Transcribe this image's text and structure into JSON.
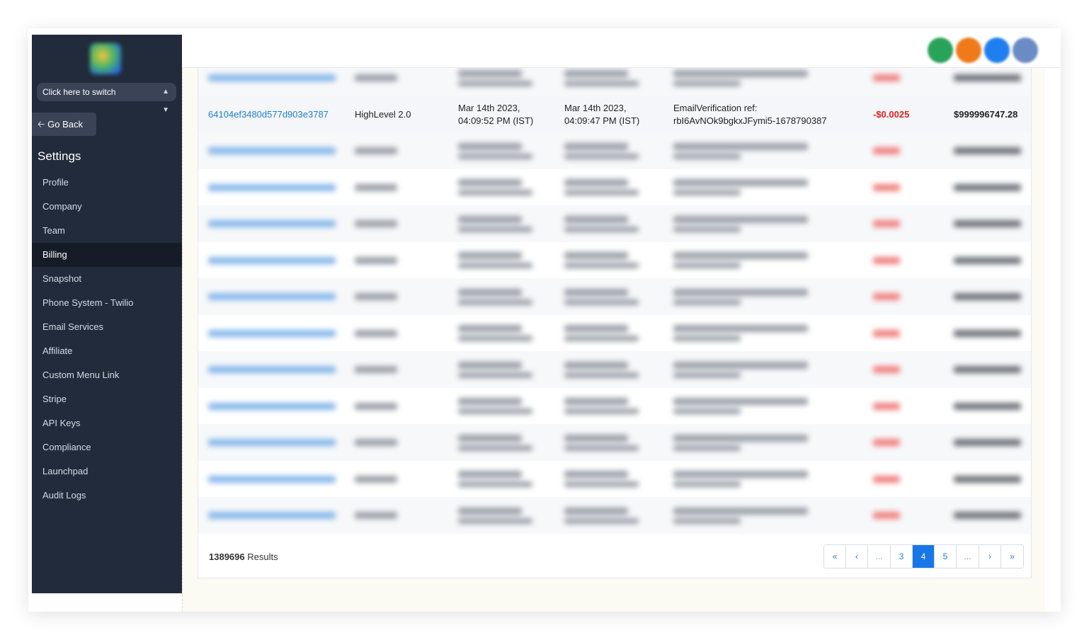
{
  "sidebar": {
    "switcher_label": "Click here to switch",
    "go_back": "Go Back",
    "settings_title": "Settings",
    "items": [
      "Profile",
      "Company",
      "Team",
      "Billing",
      "Snapshot",
      "Phone System - Twilio",
      "Email Services",
      "Affiliate",
      "Custom Menu Link",
      "Stripe",
      "API Keys",
      "Compliance",
      "Launchpad",
      "Audit Logs"
    ],
    "active_item": "Billing"
  },
  "topbar": {
    "avatars": [
      {
        "icon": "avatar-green-icon",
        "color": "#2aa35a"
      },
      {
        "icon": "avatar-orange-icon",
        "color": "#f07a1a"
      },
      {
        "icon": "avatar-blue-icon",
        "color": "#1f7ff0"
      },
      {
        "icon": "avatar-slate-icon",
        "color": "#6b8bc4"
      }
    ]
  },
  "transactions": {
    "visible_row": {
      "id": "64104ef3480d577d903e3787",
      "source": "HighLevel 2.0",
      "created_line1": "Mar 14th 2023,",
      "created_line2": "04:09:52 PM (IST)",
      "updated_line1": "Mar 14th 2023,",
      "updated_line2": "04:09:47 PM (IST)",
      "desc_line1": "EmailVerification ref:",
      "desc_line2": "rbI6AvNOk9bgkxJFymi5-1678790387",
      "amount": "-$0.0025",
      "balance": "$999996747.28"
    },
    "blurred_rows_count": 12
  },
  "footer": {
    "results_count": "1389696",
    "results_label": "Results",
    "pages": [
      "«",
      "‹",
      "...",
      "3",
      "4",
      "5",
      "...",
      "›",
      "»"
    ],
    "active_page": "4"
  }
}
